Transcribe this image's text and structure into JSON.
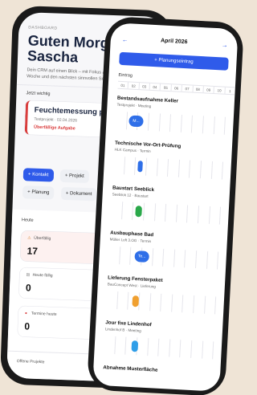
{
  "dashboard": {
    "eyebrow": "DASHBOARD",
    "greeting_line1": "Guten Morgen,",
    "greeting_line2": "Sascha",
    "intro_line1": "Dein CRM auf einen Blick – mit Fokus auf diese",
    "intro_line2": "Woche und den nächsten sinnvollen Schritt.",
    "important_label": "Jetzt wichtig",
    "highlight": {
      "title": "Feuchtemessung prüfen",
      "meta": "Testprojekt · 02.04.2026",
      "status": "Überfällige Aufgabe"
    },
    "actions": [
      "+ Kontakt",
      "+ Projekt",
      "+ Planung",
      "+ Dokument"
    ],
    "today_label": "Heute",
    "stats": [
      {
        "label": "Überfällig",
        "value": "17"
      },
      {
        "label": "Heute fällig",
        "value": "0"
      },
      {
        "label": "Termine heute",
        "value": "0"
      }
    ],
    "open_projects_label": "Offene Projekte"
  },
  "planner": {
    "prev_icon": "arrow-left-icon",
    "month": "April 2026",
    "next_icon": "arrow-right-icon",
    "add_button": "+ Planungseintrag",
    "entry_label": "Eintrag",
    "days": [
      "01",
      "02",
      "03",
      "04",
      "05",
      "06",
      "07",
      "08",
      "09",
      "10",
      "1"
    ],
    "tasks": [
      {
        "title": "Bestandsaufnahme Keller",
        "sub": "Testprojekt · Meeting",
        "bar_label": "M...",
        "color": "#2f6fe8"
      },
      {
        "title": "Technische Vor-Ort-Prüfung",
        "sub": "HLK Campus · Termin",
        "bar_label": "",
        "color": "#2f6fe8"
      },
      {
        "title": "Baustart Seeblick",
        "sub": "Seeblick 12 · Baustart",
        "bar_label": "",
        "color": "#2aa84a"
      },
      {
        "title": "Ausbauphase Bad",
        "sub": "Müller Loft 3.OG · Termin",
        "bar_label": "Te...",
        "color": "#2f6fe8"
      },
      {
        "title": "Lieferung Fensterpaket",
        "sub": "BauConcept West · Lieferung",
        "bar_label": "",
        "color": "#f0a030"
      },
      {
        "title": "Jour fixe Lindenhof",
        "sub": "Lindenhof B · Meeting",
        "bar_label": "",
        "color": "#2f9ee8"
      },
      {
        "title": "Abnahme Musterfläche",
        "sub": "",
        "bar_label": "",
        "color": "#2f6fe8"
      }
    ]
  }
}
